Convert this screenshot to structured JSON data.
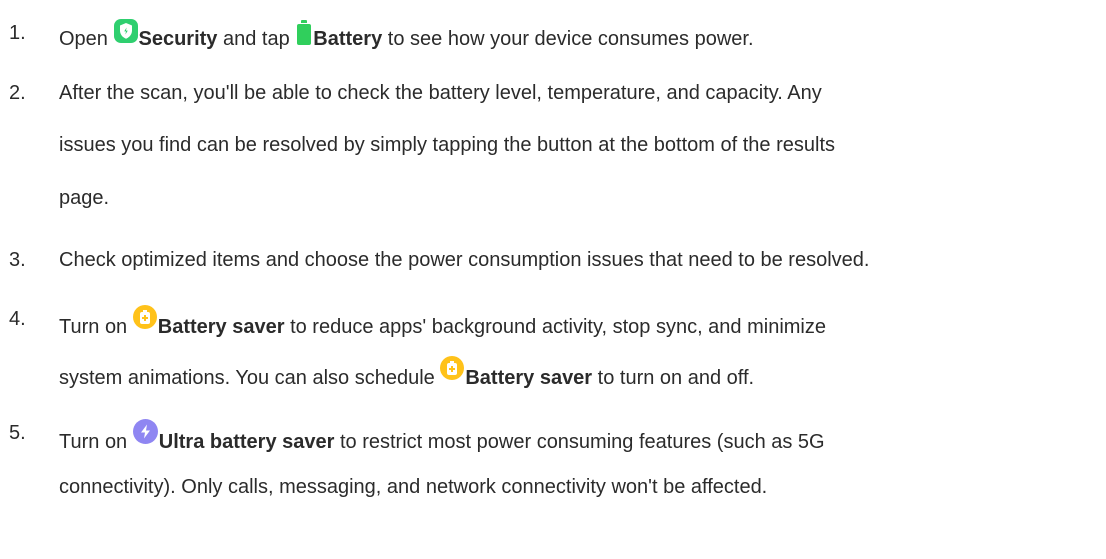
{
  "steps": [
    {
      "number": "1.",
      "lines": [
        {
          "open": "Open",
          "security": "Security",
          "and_tap": "and tap",
          "battery": "Battery",
          "tail": "to see how your device consumes power."
        }
      ]
    },
    {
      "number": "2.",
      "lines": [
        "After the scan, you'll be able to check the battery level, temperature, and capacity. Any",
        "issues you find can be resolved by simply tapping the button at the bottom of the results",
        "page."
      ]
    },
    {
      "number": "3.",
      "lines": [
        "Check optimized items and choose the power consumption issues that need to be resolved."
      ]
    },
    {
      "number": "4.",
      "line1": {
        "turn_on": "Turn on",
        "battery_saver": "Battery saver",
        "tail": "to reduce apps' background activity, stop sync, and minimize"
      },
      "line2": {
        "lead": "system animations. You can also schedule",
        "battery_saver": "Battery saver",
        "tail": "to turn on and off."
      }
    },
    {
      "number": "5.",
      "line1": {
        "turn_on": "Turn on",
        "ultra_battery_saver": "Ultra battery saver",
        "tail": "to restrict most power consuming features (such as 5G"
      },
      "line2": "connectivity). Only calls, messaging, and network connectivity won't be affected."
    }
  ],
  "icons": {
    "security": "security-shield-icon",
    "battery": "battery-icon",
    "battery_saver": "battery-saver-icon",
    "ultra_battery_saver": "ultra-battery-saver-icon"
  },
  "colors": {
    "text": "#2b2b2b",
    "security_green": "#2fcf6f",
    "battery_green": "#30cf5c",
    "saver_yellow": "#ffc21a",
    "ultra_purple": "#8f86f2"
  }
}
